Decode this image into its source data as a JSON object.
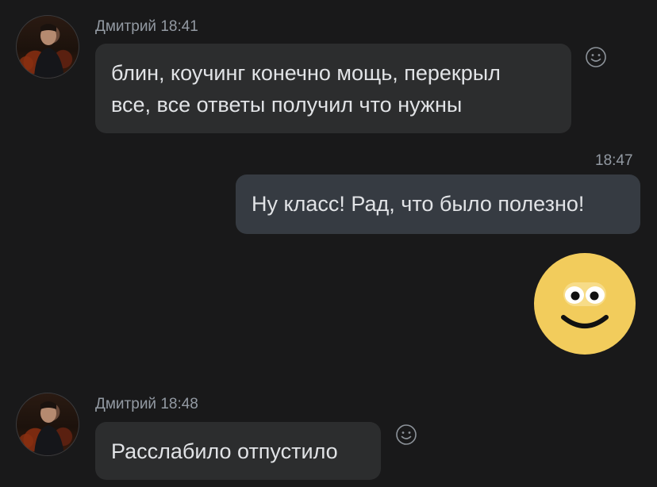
{
  "messages": [
    {
      "sender": "Дмитрий",
      "time": "18:41",
      "text_line1": "блин, коучинг конечно мощь, перекрыл",
      "text_line2": "все, все ответы получил что нужны"
    },
    {
      "time": "18:47",
      "text": "Ну класс! Рад, что было полезно!"
    },
    {
      "sticker": "smiling-face-sticker"
    },
    {
      "sender": "Дмитрий",
      "time": "18:48",
      "text": "Расслабило отпустило"
    }
  ],
  "colors": {
    "background": "#19191a",
    "incoming_bubble": "#2c2d2e",
    "outgoing_bubble": "#363b42",
    "sticker_face": "#f2cc5c",
    "meta_text": "#939aa3"
  },
  "icons": {
    "reaction": "smile-icon"
  }
}
